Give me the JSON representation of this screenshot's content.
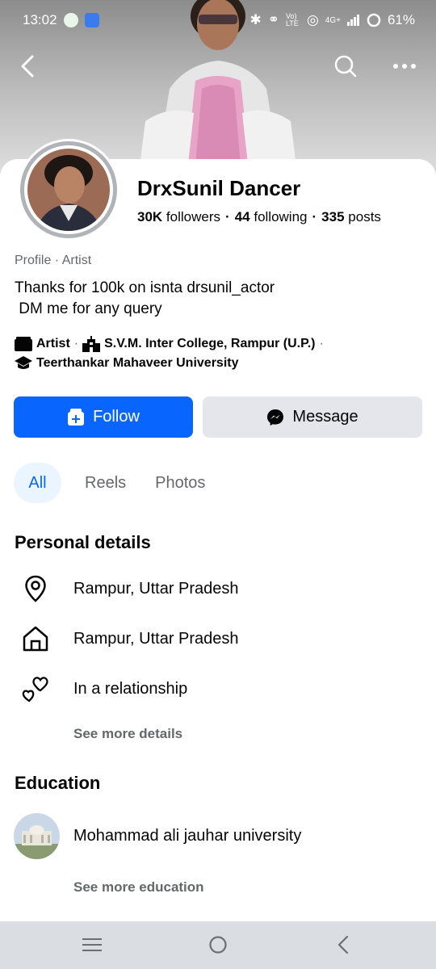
{
  "status_bar": {
    "time": "13:02",
    "network": "Vo) LTE",
    "signal": "4G+",
    "battery": "61%"
  },
  "profile": {
    "name": "DrxSunil Dancer",
    "followers_count": "30K",
    "followers_label": "followers",
    "following_count": "44",
    "following_label": "following",
    "posts_count": "335",
    "posts_label": "posts",
    "subtitle": "Profile · Artist",
    "bio": "Thanks for 100k on isnta drsunil_actor\n DM me for any query",
    "work_items": [
      {
        "icon": "clapperboard-icon",
        "label": "Artist"
      },
      {
        "icon": "school-building-icon",
        "label": "S.V.M. Inter College, Rampur (U.P.)"
      },
      {
        "icon": "graduation-cap-icon",
        "label": "Teerthankar Mahaveer University"
      }
    ]
  },
  "actions": {
    "follow_label": "Follow",
    "message_label": "Message"
  },
  "tabs": [
    {
      "label": "All",
      "active": true
    },
    {
      "label": "Reels",
      "active": false
    },
    {
      "label": "Photos",
      "active": false
    }
  ],
  "personal_details": {
    "title": "Personal details",
    "items": [
      {
        "icon": "location-pin-icon",
        "text": "Rampur, Uttar Pradesh"
      },
      {
        "icon": "home-icon",
        "text": "Rampur, Uttar Pradesh"
      },
      {
        "icon": "hearts-icon",
        "text": "In a relationship"
      }
    ],
    "see_more": "See more details"
  },
  "education": {
    "title": "Education",
    "items": [
      {
        "icon": "university-thumbnail",
        "text": "Mohammad ali jauhar university"
      }
    ],
    "see_more": "See more education"
  },
  "colors": {
    "accent": "#0866ff",
    "secondary_button": "#e4e6eb",
    "muted_text": "#65676b",
    "tab_active_bg": "#ebf5ff"
  }
}
